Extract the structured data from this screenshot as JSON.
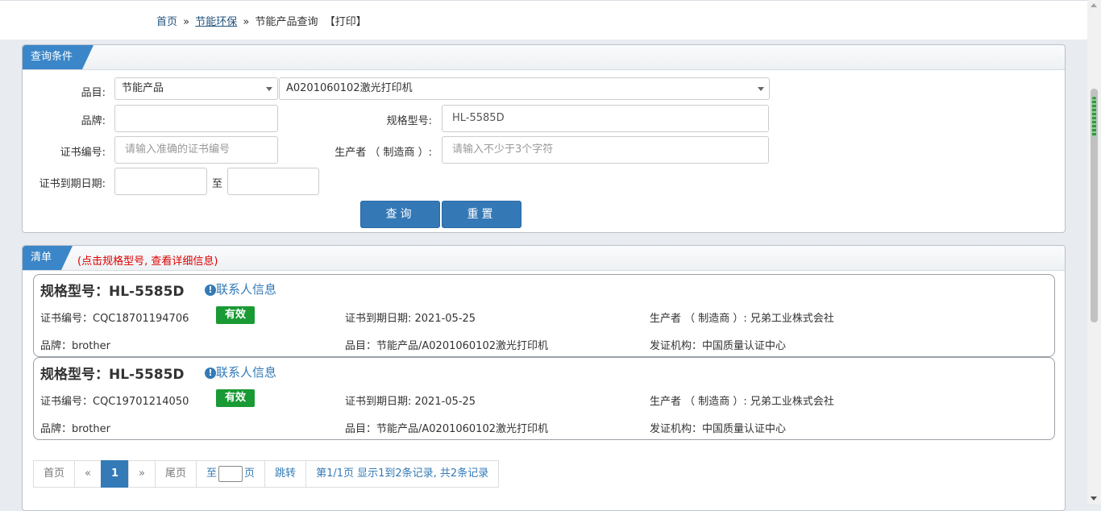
{
  "breadcrumb": {
    "home": "首页",
    "sep": "»",
    "category": "节能环保",
    "current": "节能产品查询",
    "print": "【打印】"
  },
  "query_panel": {
    "title": "查询条件",
    "category_label": "品目:",
    "category_value": "节能产品",
    "subcategory_value": "A0201060102激光打印机",
    "brand_label": "品牌:",
    "brand_value": "",
    "model_label": "规格型号:",
    "model_value": "HL-5585D",
    "cert_no_label": "证书编号:",
    "cert_no_placeholder": "请输入准确的证书编号",
    "maker_label": "生产者 （ 制造商 ）:",
    "maker_placeholder": "请输入不少于3个字符",
    "expiry_label": "证书到期日期:",
    "expiry_to": "至",
    "query_button": "查询",
    "reset_button": "重置"
  },
  "list_panel": {
    "title": "清单",
    "note": "(点击规格型号, 查看详细信息)",
    "contact_label": "联系人信息",
    "items": [
      {
        "model": "规格型号：HL-5585D",
        "cert": "证书编号：CQC18701194706",
        "status": "有效",
        "expiry": "证书到期日期: 2021-05-25",
        "maker": "生产者 （ 制造商 ）: 兄弟工业株式会社",
        "brand": "品牌：brother",
        "category": "品目：节能产品/A0201060102激光打印机",
        "issuer": "发证机构：中国质量认证中心"
      },
      {
        "model": "规格型号：HL-5585D",
        "cert": "证书编号：CQC19701214050",
        "status": "有效",
        "expiry": "证书到期日期: 2021-05-25",
        "maker": "生产者 （ 制造商 ）: 兄弟工业株式会社",
        "brand": "品牌：brother",
        "category": "品目：节能产品/A0201060102激光打印机",
        "issuer": "发证机构：中国质量认证中心"
      }
    ]
  },
  "pagination": {
    "first": "首页",
    "prev": "«",
    "current": "1",
    "next": "»",
    "last": "尾页",
    "goto_prefix": "至",
    "goto_suffix": "页",
    "jump": "跳转",
    "summary": "第1/1页  显示1到2条记录, 共2条记录"
  },
  "colors": {
    "accent": "#337ab7",
    "valid_badge": "#1a9a34",
    "note_red": "#dd0000"
  }
}
